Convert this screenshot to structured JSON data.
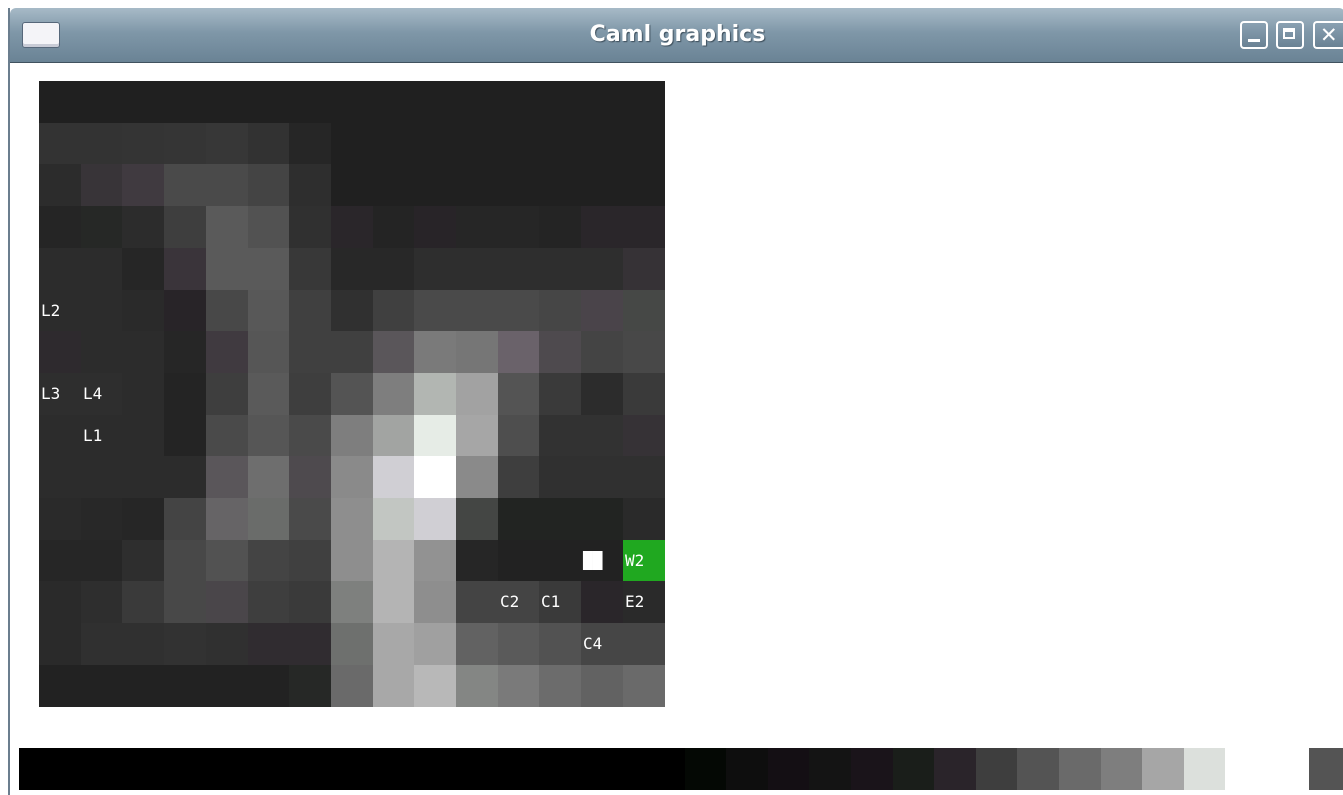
{
  "window": {
    "title": "Caml graphics",
    "icons": [
      "app-window-icon",
      "minimize-icon",
      "maximize-icon",
      "close-icon"
    ]
  },
  "heatmap": {
    "rows": 15,
    "cols": 15,
    "colors": [
      [
        "#202020",
        "#202020",
        "#202020",
        "#202020",
        "#202020",
        "#202020",
        "#202020",
        "#202020",
        "#202020",
        "#202020",
        "#202020",
        "#202020",
        "#202020",
        "#202020",
        "#202020"
      ],
      [
        "#333333",
        "#333333",
        "#343434",
        "#353535",
        "#373737",
        "#323232",
        "#262626",
        "#202020",
        "#202020",
        "#202020",
        "#202020",
        "#202020",
        "#202020",
        "#202020",
        "#202020"
      ],
      [
        "#2c2c2c",
        "#383438",
        "#403a40",
        "#4a4a4a",
        "#4a4a4a",
        "#444444",
        "#2e2e2e",
        "#202020",
        "#202020",
        "#202020",
        "#202020",
        "#202020",
        "#202020",
        "#202020",
        "#202020"
      ],
      [
        "#252525",
        "#262826",
        "#2c2c2c",
        "#3e3e3e",
        "#5a5a5a",
        "#525252",
        "#303030",
        "#2a262a",
        "#242424",
        "#282428",
        "#262626",
        "#262626",
        "#242424",
        "#2a262a",
        "#2a262a"
      ],
      [
        "#2c2c2c",
        "#2c2c2c",
        "#262626",
        "#3a343a",
        "#5a5a5a",
        "#5a5a5a",
        "#383838",
        "#282828",
        "#282828",
        "#2e2e2e",
        "#2e2e2e",
        "#2e2e2e",
        "#2e2e2e",
        "#2e2e2e",
        "#363236"
      ],
      [
        "#2c2c2c",
        "#2c2c2c",
        "#2a2a2a",
        "#282428",
        "#484848",
        "#585858",
        "#404040",
        "#303030",
        "#404040",
        "#4a4a4a",
        "#4a4a4a",
        "#4a4a4a",
        "#464646",
        "#4a444a",
        "#464846"
      ],
      [
        "#2e2a2e",
        "#2c2c2c",
        "#2c2c2c",
        "#262626",
        "#403a40",
        "#565656",
        "#404040",
        "#404040",
        "#5a565a",
        "#7a7a7a",
        "#767676",
        "#6a626a",
        "#4e4a4e",
        "#444444",
        "#484848"
      ],
      [
        "#2e2e2e",
        "#2e2e2e",
        "#2c2c2c",
        "#242424",
        "#3e3e3e",
        "#5a5a5a",
        "#3e3e3e",
        "#545454",
        "#7e7e7e",
        "#b2b6b2",
        "#a2a2a2",
        "#545454",
        "#3a3a3a",
        "#2c2c2c",
        "#3a3a3a"
      ],
      [
        "#2c2c2c",
        "#2c2c2c",
        "#2c2c2c",
        "#242424",
        "#4a4a4a",
        "#565656",
        "#4a4a4a",
        "#7e7e7e",
        "#a2a4a2",
        "#e6ece6",
        "#a6a6a6",
        "#4e4e4e",
        "#323232",
        "#323232",
        "#363236"
      ],
      [
        "#2c2c2c",
        "#2c2c2c",
        "#2c2c2c",
        "#2c2c2c",
        "#5a565a",
        "#6e6e6e",
        "#4e4a4e",
        "#8a8a8a",
        "#d0cfd4",
        "#ffffff",
        "#8a8a8a",
        "#3e3e3e",
        "#303030",
        "#303030",
        "#303030"
      ],
      [
        "#2a2a2a",
        "#282828",
        "#262626",
        "#444444",
        "#666466",
        "#6a6c6a",
        "#4a4a4a",
        "#8e8e8e",
        "#c2c6c2",
        "#d0cfd4",
        "#444644",
        "#222422",
        "#222422",
        "#222422",
        "#2a2a2a"
      ],
      [
        "#262626",
        "#262626",
        "#2e2e2e",
        "#484848",
        "#525252",
        "#444444",
        "#404040",
        "#8e8e8e",
        "#b4b4b4",
        "#929292",
        "#262626",
        "#222222",
        "#222222",
        "#222222",
        "#20a820"
      ],
      [
        "#2a2a2a",
        "#2e2e2e",
        "#3a3a3a",
        "#484848",
        "#4a464a",
        "#3e3e3e",
        "#3a3a3a",
        "#7e807e",
        "#b4b4b4",
        "#8e8e8e",
        "#444444",
        "#444444",
        "#3a3a3a",
        "#2a262a",
        "#2a2a2a"
      ],
      [
        "#2a2a2a",
        "#303030",
        "#303030",
        "#323232",
        "#303030",
        "#302c30",
        "#302c30",
        "#6e706e",
        "#a8a8a8",
        "#a0a0a0",
        "#626262",
        "#5a5a5a",
        "#525252",
        "#464646",
        "#464646"
      ],
      [
        "#222222",
        "#222222",
        "#222222",
        "#222222",
        "#222222",
        "#222222",
        "#262826",
        "#6a6a6a",
        "#a8a8a8",
        "#b8b8b8",
        "#848684",
        "#7a7a7a",
        "#6c6c6c",
        "#626262",
        "#6a6a6a"
      ]
    ],
    "labels": [
      {
        "text": "L2",
        "row": 5,
        "col": 0
      },
      {
        "text": "L3",
        "row": 7,
        "col": 0
      },
      {
        "text": "L4",
        "row": 7,
        "col": 1
      },
      {
        "text": "L1",
        "row": 8,
        "col": 1
      },
      {
        "text": "██",
        "row": 11,
        "col": 13
      },
      {
        "text": "W2",
        "row": 11,
        "col": 14
      },
      {
        "text": "C2",
        "row": 12,
        "col": 11
      },
      {
        "text": "C1",
        "row": 12,
        "col": 12
      },
      {
        "text": "E2",
        "row": 12,
        "col": 14
      },
      {
        "text": "C4",
        "row": 13,
        "col": 13
      }
    ]
  },
  "palette": {
    "colors": [
      "#000000",
      "#000000",
      "#000000",
      "#000000",
      "#000000",
      "#000000",
      "#000000",
      "#000000",
      "#000000",
      "#000000",
      "#000000",
      "#000000",
      "#000000",
      "#000000",
      "#000000",
      "#000000",
      "#040804",
      "#0e0e0e",
      "#140f14",
      "#141414",
      "#1a141a",
      "#1a1e1a",
      "#2a242a",
      "#3e3e3e",
      "#545454",
      "#6a6a6a",
      "#7e7e7e",
      "#a6a6a6",
      "#dce0dc",
      "#ffffff",
      "#ffffff",
      "#545454",
      "#040804",
      "#101410"
    ]
  }
}
